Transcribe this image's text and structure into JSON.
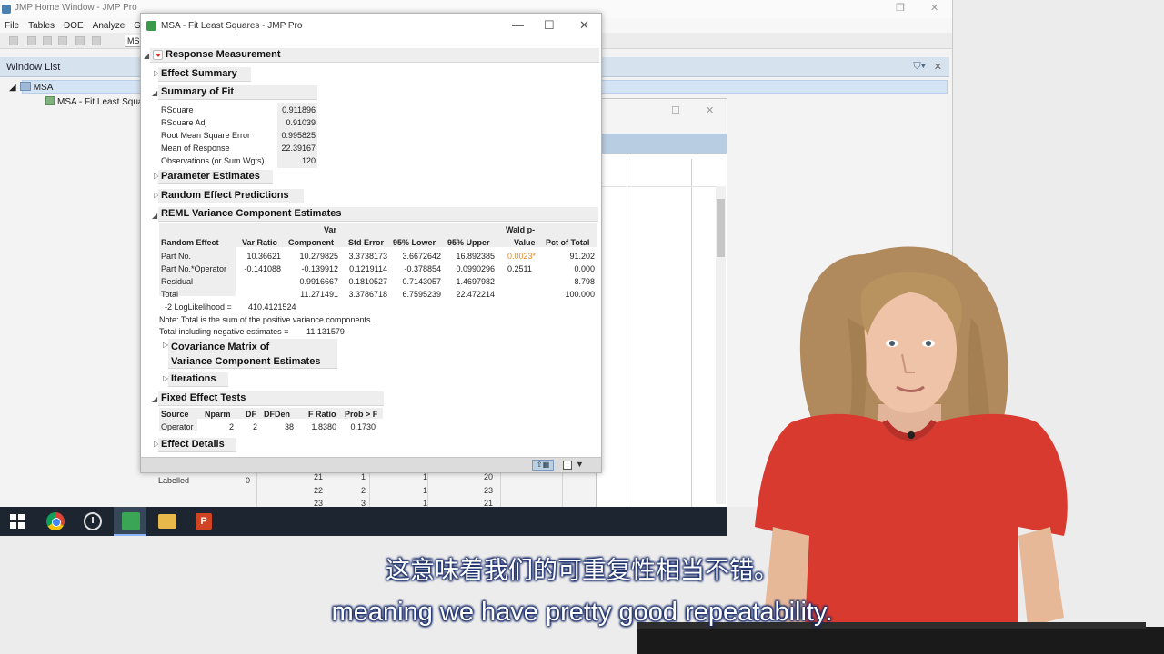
{
  "home": {
    "title": "JMP Home Window - JMP Pro",
    "menu": [
      "File",
      "Tables",
      "DOE",
      "Analyze",
      "Gr"
    ],
    "combo": "MS",
    "window_list_title": "Window List",
    "tree_root": "MSA",
    "tree_child": "MSA - Fit Least Square"
  },
  "report": {
    "title": "MSA - Fit Least Squares - JMP Pro",
    "response_header": "Response Measurement",
    "effect_summary": "Effect Summary",
    "summary_of_fit": {
      "header": "Summary of Fit",
      "rows": [
        {
          "label": "RSquare",
          "value": "0.911896"
        },
        {
          "label": "RSquare Adj",
          "value": "0.91039"
        },
        {
          "label": "Root Mean Square Error",
          "value": "0.995825"
        },
        {
          "label": "Mean of Response",
          "value": "22.39167"
        },
        {
          "label": "Observations (or Sum Wgts)",
          "value": "120"
        }
      ]
    },
    "parameter_estimates": "Parameter Estimates",
    "random_effect_predictions": "Random Effect Predictions",
    "reml": {
      "header": "REML Variance Component Estimates",
      "col_headers": {
        "random_effect": "Random Effect",
        "var_ratio": "Var Ratio",
        "var_component_1": "Var",
        "var_component_2": "Component",
        "std_error": "Std Error",
        "lower": "95% Lower",
        "upper": "95% Upper",
        "wald_1": "Wald p-",
        "wald_2": "Value",
        "pct": "Pct of Total"
      },
      "rows": [
        {
          "effect": "Part No.",
          "var_ratio": "10.36621",
          "var_component": "10.279825",
          "std_error": "3.3738173",
          "lower": "3.6672642",
          "upper": "16.892385",
          "wald": "0.0023*",
          "pct": "91.202"
        },
        {
          "effect": "Part No.*Operator",
          "var_ratio": "-0.141088",
          "var_component": "-0.139912",
          "std_error": "0.1219114",
          "lower": "-0.378854",
          "upper": "0.0990296",
          "wald": "0.2511",
          "pct": "0.000"
        },
        {
          "effect": "Residual",
          "var_ratio": "",
          "var_component": "0.9916667",
          "std_error": "0.1810527",
          "lower": "0.7143057",
          "upper": "1.4697982",
          "wald": "",
          "pct": "8.798"
        },
        {
          "effect": "Total",
          "var_ratio": "",
          "var_component": "11.271491",
          "std_error": "3.3786718",
          "lower": "6.7595239",
          "upper": "22.472214",
          "wald": "",
          "pct": "100.000"
        }
      ],
      "loglik_label": "-2 LogLikelihood =",
      "loglik_value": "410.4121524",
      "note": "Note: Total is the sum of the positive variance components.",
      "neg_label": "Total including negative estimates =",
      "neg_value": "11.131579",
      "wald_sig_color": "#e08a2c"
    },
    "covariance_1": "Covariance Matrix of",
    "covariance_2": "Variance Component Estimates",
    "iterations": "Iterations",
    "fixed_effect": {
      "header": "Fixed Effect Tests",
      "cols": [
        "Source",
        "Nparm",
        "DF",
        "DFDen",
        "F Ratio",
        "Prob > F"
      ],
      "row": [
        "Operator",
        "2",
        "2",
        "38",
        "1.8380",
        "0.1730"
      ]
    },
    "effect_details": "Effect Details"
  },
  "background_table": {
    "labelled": "Labelled",
    "labelled_value": "0",
    "rows": [
      [
        "21",
        "1",
        "1",
        "20"
      ],
      [
        "22",
        "2",
        "1",
        "23"
      ],
      [
        "23",
        "3",
        "1",
        "21"
      ]
    ]
  },
  "subtitles": {
    "chinese": "这意味着我们的可重复性相当不错。",
    "english": "meaning we have pretty good repeatability."
  }
}
